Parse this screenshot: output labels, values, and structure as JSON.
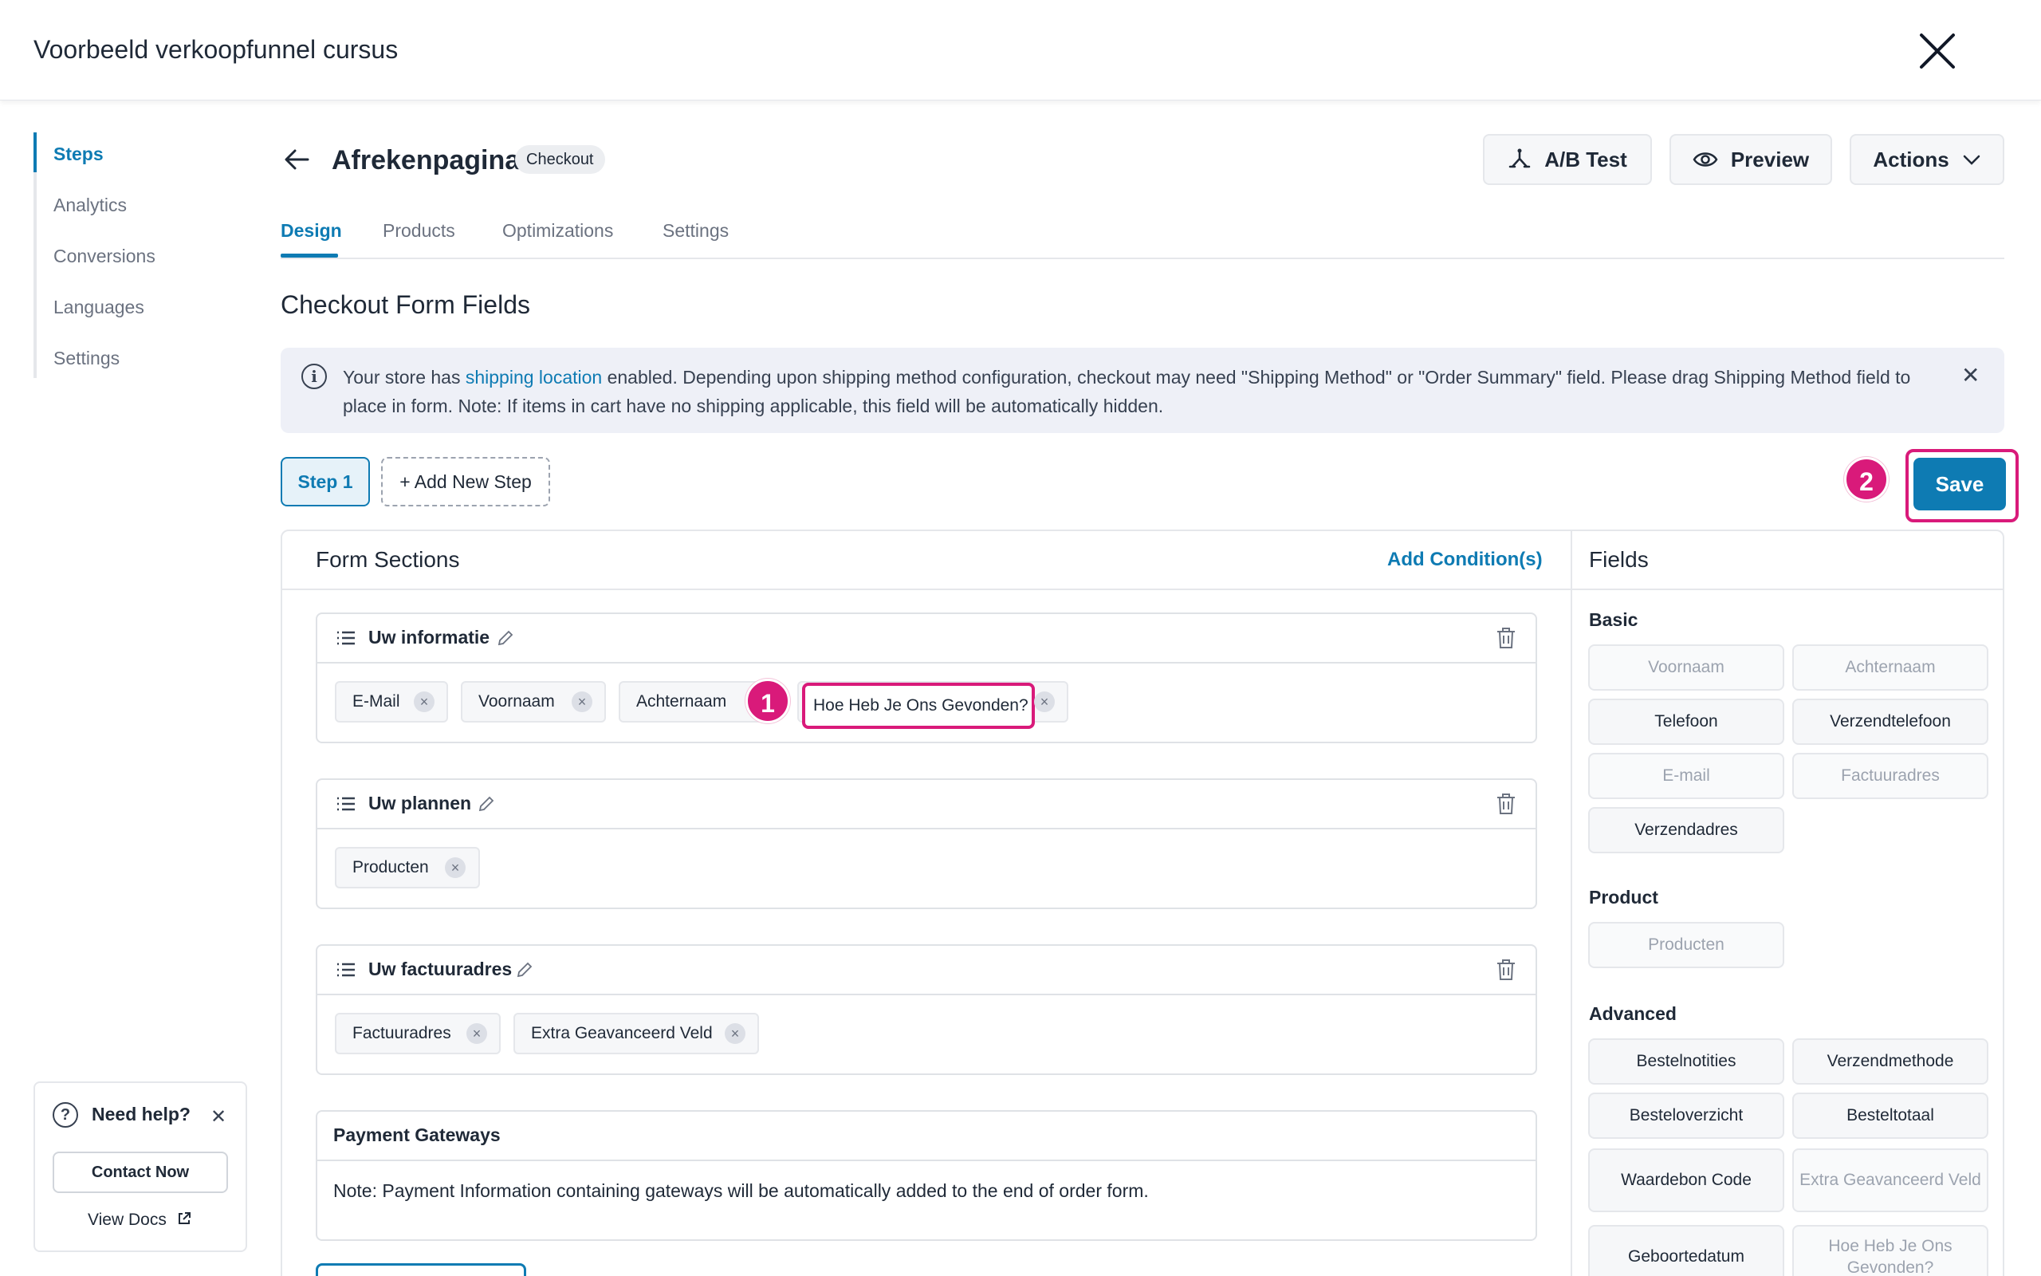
{
  "app": {
    "title": "Voorbeeld verkoopfunnel cursus"
  },
  "leftnav": {
    "items": [
      {
        "label": "Steps",
        "active": true
      },
      {
        "label": "Analytics",
        "active": false
      },
      {
        "label": "Conversions",
        "active": false
      },
      {
        "label": "Languages",
        "active": false
      },
      {
        "label": "Settings",
        "active": false
      }
    ]
  },
  "help": {
    "title": "Need help?",
    "contact_label": "Contact Now",
    "docs_label": "View Docs"
  },
  "page": {
    "title": "Afrekenpagina",
    "badge": "Checkout",
    "ab_test_label": "A/B Test",
    "preview_label": "Preview",
    "actions_label": "Actions"
  },
  "tabs": [
    {
      "label": "Design",
      "active": true
    },
    {
      "label": "Products",
      "active": false
    },
    {
      "label": "Optimizations",
      "active": false
    },
    {
      "label": "Settings",
      "active": false
    }
  ],
  "section_title": "Checkout Form Fields",
  "notice": {
    "prefix": "Your store has ",
    "link": "shipping location",
    "suffix": " enabled. Depending upon shipping method configuration, checkout may need \"Shipping Method\" or \"Order Summary\" field. Please drag Shipping Method field to place in form. Note: If items in cart have no shipping applicable, this field will be automatically hidden."
  },
  "steps": {
    "step1": "Step 1",
    "add_step": "+ Add New Step"
  },
  "save_label": "Save",
  "markers": {
    "m1": "1",
    "m2": "2"
  },
  "builder": {
    "title": "Form Sections",
    "add_condition": "Add Condition(s)",
    "sections": [
      {
        "title": "Uw informatie",
        "chips": [
          "E-Mail",
          "Voornaam",
          "Achternaam",
          "Hoe Heb Je Ons Gevonden?"
        ]
      },
      {
        "title": "Uw plannen",
        "chips": [
          "Producten"
        ]
      },
      {
        "title": "Uw factuuradres",
        "chips": [
          "Factuuradres",
          "Extra Geavanceerd Veld"
        ]
      }
    ],
    "payment": {
      "title": "Payment Gateways",
      "note": "Note: Payment Information containing gateways will be automatically added to the end of order form."
    }
  },
  "fields_panel": {
    "title": "Fields",
    "basic_title": "Basic",
    "basic": [
      "Voornaam",
      "Achternaam",
      "Telefoon",
      "Verzendtelefoon",
      "E-mail",
      "Factuuradres",
      "Verzendadres"
    ],
    "product_title": "Product",
    "product": [
      "Producten"
    ],
    "advanced_title": "Advanced",
    "advanced": [
      "Bestelnotities",
      "Verzendmethode",
      "Besteloverzicht",
      "Besteltotaal",
      "Waardebon Code",
      "Extra Geavanceerd Veld",
      "Geboortedatum",
      "Hoe Heb Je Ons Gevonden?"
    ]
  },
  "colors": {
    "accent": "#0e7bb3",
    "highlight": "#d91a7a"
  }
}
